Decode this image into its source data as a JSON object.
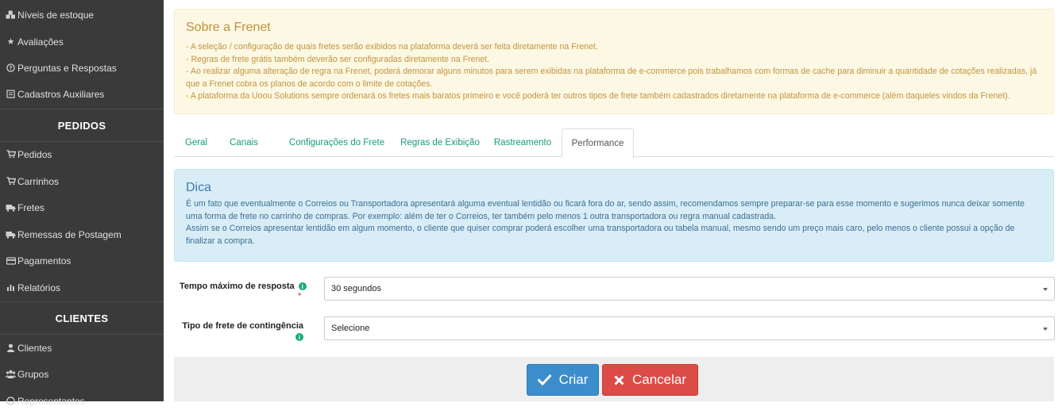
{
  "sidebar": {
    "items_top": [
      {
        "label": "Níveis de estoque",
        "icon": "cubes-icon"
      },
      {
        "label": "Avaliações",
        "icon": "star-icon"
      },
      {
        "label": "Perguntas e Respostas",
        "icon": "question-circle-icon"
      },
      {
        "label": "Cadastros Auxiliares",
        "icon": "list-icon"
      }
    ],
    "section_pedidos": "PEDIDOS",
    "items_pedidos": [
      {
        "label": "Pedidos",
        "icon": "cart-icon"
      },
      {
        "label": "Carrinhos",
        "icon": "cart-icon"
      },
      {
        "label": "Fretes",
        "icon": "truck-icon"
      },
      {
        "label": "Remessas de Postagem",
        "icon": "truck-icon"
      },
      {
        "label": "Pagamentos",
        "icon": "credit-card-icon"
      },
      {
        "label": "Relatórios",
        "icon": "bar-chart-icon"
      }
    ],
    "section_clientes": "CLIENTES",
    "items_clientes": [
      {
        "label": "Clientes",
        "icon": "user-icon"
      },
      {
        "label": "Grupos",
        "icon": "users-icon"
      },
      {
        "label": "Representantes",
        "icon": "user-circle-icon"
      }
    ]
  },
  "about": {
    "title": "Sobre a Frenet",
    "lines": [
      "- A seleção / configuração de quais fretes serão exibidos na plataforma deverá ser feita diretamente na Frenet.",
      "- Regras de frete grátis também deverão ser configuradas diretamente na Frenet.",
      "- Ao realizar alguma alteração de regra na Frenet, poderá demorar alguns minutos para serem exibidas na plataforma de e-commerce pois trabalhamos com formas de cache para diminuir a quantidade de cotações realizadas, já que a Frenet cobra os planos de acordo com o limite de cotações.",
      "- A plataforma da Uoou Solutions sempre ordenará os fretes mais baratos primeiro e você poderá ter outros tipos de frete também cadastrados diretamente na plataforma de e-commerce (além daqueles vindos da Frenet)."
    ]
  },
  "tabs": [
    {
      "label": "Geral"
    },
    {
      "label": "Canais"
    },
    {
      "label": "Configurações do Frete"
    },
    {
      "label": "Regras de Exibição"
    },
    {
      "label": "Rastreamento"
    },
    {
      "label": "Performance"
    }
  ],
  "active_tab": "Performance",
  "tip": {
    "title": "Dica",
    "lines": [
      "É um fato que eventualmente o Correios ou Transportadora apresentará alguma eventual lentidão ou ficará fora do ar, sendo assim, recomendamos sempre preparar-se para esse momento e sugerimos nunca deixar somente uma forma de frete no carrinho de compras. Por exemplo: além de ter o Correios, ter também pelo menos 1 outra transportadora ou regra manual cadastrada.",
      "Assim se o Correios apresentar lentidão em algum momento, o cliente que quiser comprar poderá escolher uma transportadora ou tabela manual, mesmo sendo um preço mais caro, pelo menos o cliente possui a opção de finalizar a compra."
    ]
  },
  "form": {
    "max_time_label": "Tempo máximo de resposta",
    "max_time_required": "*",
    "max_time_value": "30 segundos",
    "contingency_label": "Tipo de frete de contingência",
    "contingency_value": "Selecione",
    "info_glyph": "i"
  },
  "buttons": {
    "create": "Criar",
    "cancel": "Cancelar"
  },
  "colors": {
    "sidebar_bg": "#3a3a3a",
    "tab_link": "#1a9a7a",
    "primary": "#3c8dcc",
    "danger": "#dc4b45",
    "info_dot": "#1aaa7c"
  }
}
